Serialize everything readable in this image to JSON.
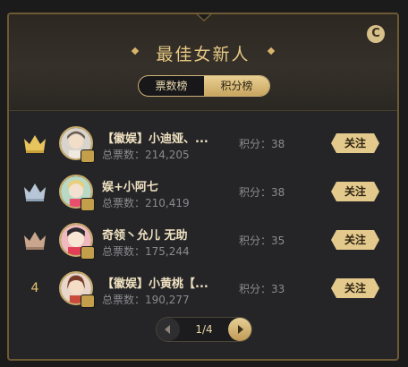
{
  "panel": {
    "title": "最佳女新人",
    "colors": {
      "gold": "#e6c983",
      "panel_bg": "#252528",
      "page_bg": "#1b1b1c"
    },
    "refresh_icon": "refresh-icon",
    "refresh_glyph": "C",
    "tabs": [
      {
        "label": "票数榜",
        "active": false
      },
      {
        "label": "积分榜",
        "active": true
      }
    ]
  },
  "list": {
    "items": [
      {
        "rank_icon": "gold-crown-icon",
        "rank": "",
        "name": "【徽娱】小迪娅、...",
        "votes": "总票数：214,205",
        "score": "积分：38",
        "follow": "关注"
      },
      {
        "rank_icon": "silver-crown-icon",
        "rank": "",
        "name": "娱+小阿七",
        "votes": "总票数：210,419",
        "score": "积分：38",
        "follow": "关注"
      },
      {
        "rank_icon": "bronze-crown-icon",
        "rank": "",
        "name": "奇领丶允儿 无助",
        "votes": "总票数：175,244",
        "score": "积分：35",
        "follow": "关注"
      },
      {
        "rank_icon": "",
        "rank": "4",
        "name": "【徽娱】小黄桃【...",
        "votes": "总票数：190,277",
        "score": "积分：33",
        "follow": "关注"
      }
    ]
  },
  "pager": {
    "text": "1/4",
    "prev_icon": "chevron-left-icon",
    "next_icon": "chevron-right-icon"
  }
}
